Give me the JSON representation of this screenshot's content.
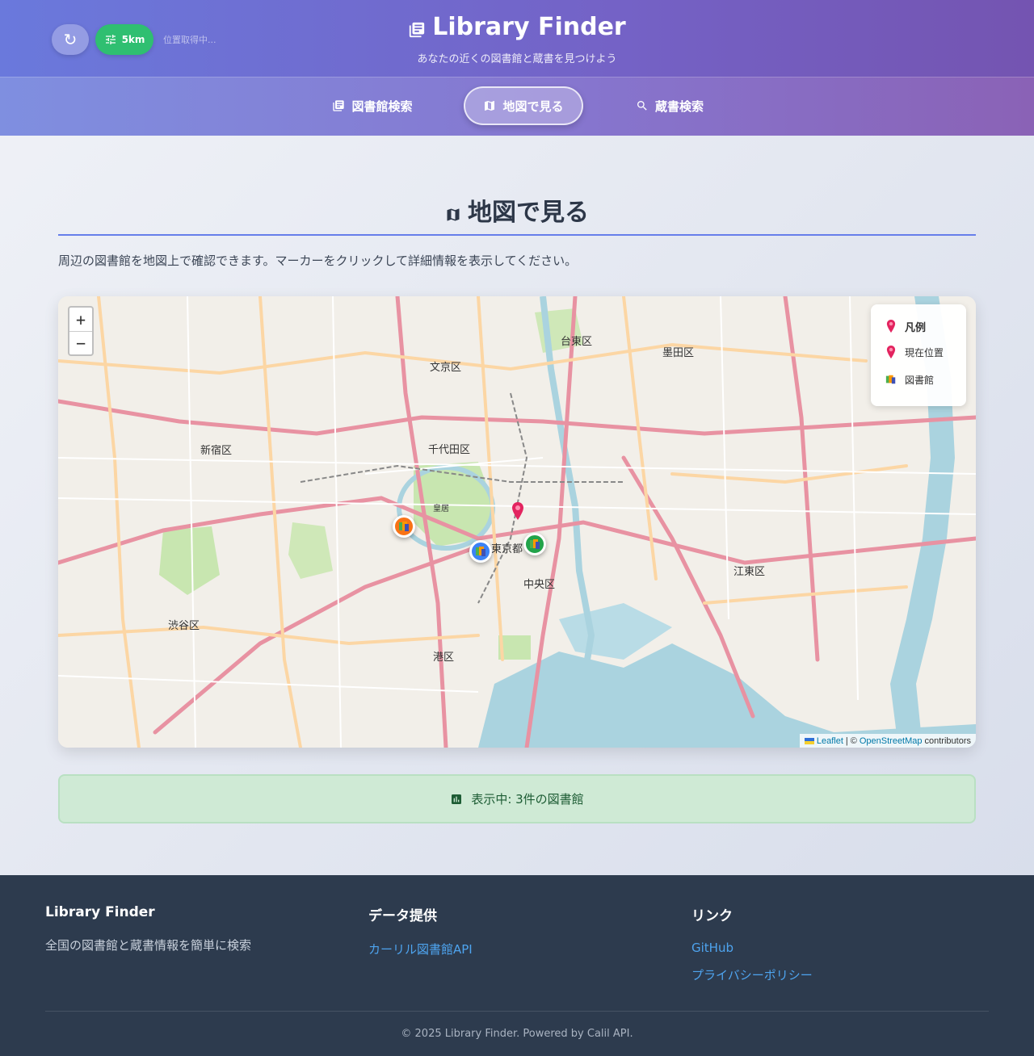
{
  "header": {
    "title": "Library Finder",
    "subtitle": "あなたの近くの図書館と蔵書を見つけよう",
    "radius_label": "5km",
    "location_status": "位置取得中..."
  },
  "nav": {
    "tabs": [
      {
        "label": "図書館検索",
        "icon": "library-books-icon",
        "active": false
      },
      {
        "label": "地図で見る",
        "icon": "map-icon",
        "active": true
      },
      {
        "label": "蔵書検索",
        "icon": "search-icon",
        "active": false
      }
    ]
  },
  "main": {
    "title": "地図で見る",
    "description": "周辺の図書館を地図上で確認できます。マーカーをクリックして詳細情報を表示してください。",
    "count_text": "表示中: 3件の図書館"
  },
  "map": {
    "zoom_in": "+",
    "zoom_out": "−",
    "legend": {
      "title": "凡例",
      "current_location": "現在位置",
      "library": "図書館"
    },
    "attribution": {
      "leaflet": "Leaflet",
      "separator": "|",
      "copyright": "©",
      "osm": "OpenStreetMap",
      "contributors": "contributors"
    },
    "labels": [
      "文京区",
      "台東区",
      "墨田区",
      "新宿区",
      "千代田区",
      "東京都",
      "中央区",
      "江東区",
      "渋谷区",
      "港区",
      "皇居"
    ],
    "markers": [
      {
        "name": "library-marker-orange",
        "color": "#f97316"
      },
      {
        "name": "library-marker-blue",
        "color": "#3b82f6"
      },
      {
        "name": "library-marker-green",
        "color": "#22a34a"
      }
    ]
  },
  "footer": {
    "brand_title": "Library Finder",
    "brand_text": "全国の図書館と蔵書情報を簡単に検索",
    "data_title": "データ提供",
    "data_link": "カーリル図書館API",
    "links_title": "リンク",
    "links": [
      "GitHub",
      "プライバシーポリシー"
    ],
    "copyright": "© 2025 Library Finder. Powered by Calil API."
  },
  "colors": {
    "header_gradient_start": "#6a79dc",
    "header_gradient_end": "#7454b1",
    "accent": "#667eea",
    "radius_button": "#2fbf71",
    "footer_bg": "#2d3b4e",
    "count_bar_bg": "#cfead5",
    "water": "#aad3df",
    "park": "#c8e6b0"
  }
}
